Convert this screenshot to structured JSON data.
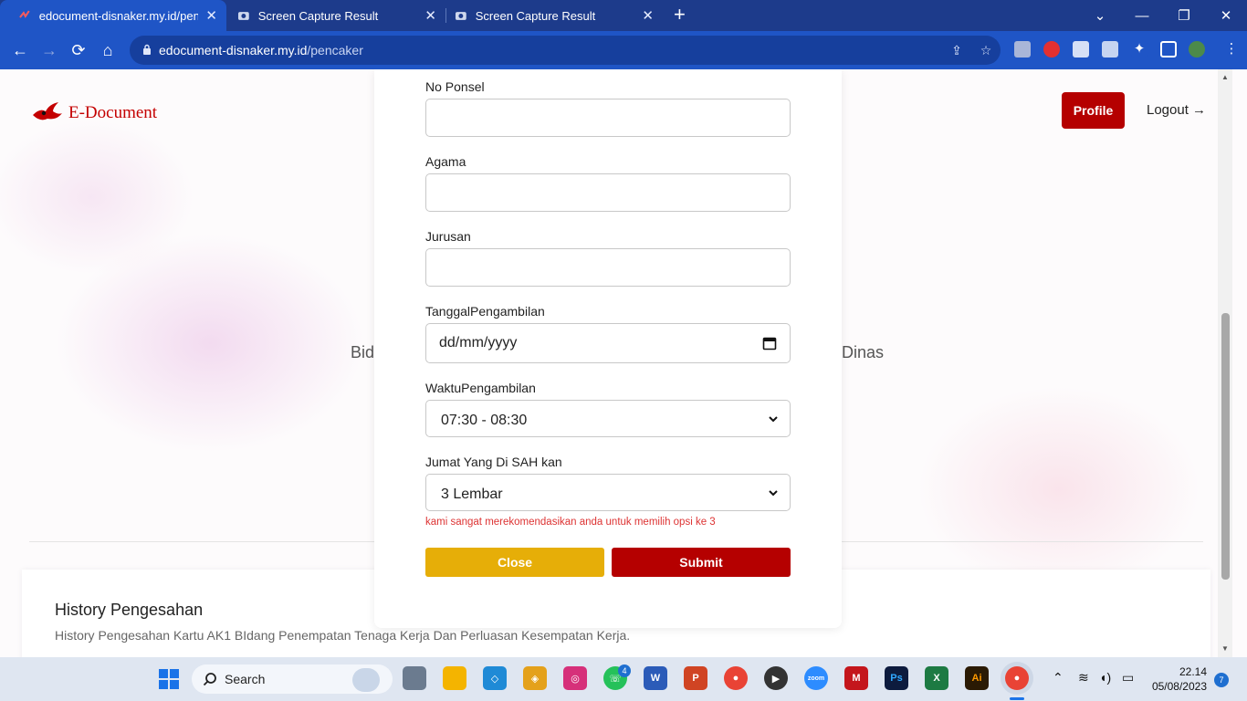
{
  "browser": {
    "tabs": [
      {
        "title": "edocument-disnaker.my.id/pencaker",
        "active": true
      },
      {
        "title": "Screen Capture Result",
        "active": false
      },
      {
        "title": "Screen Capture Result",
        "active": false
      }
    ],
    "url_domain": "edocument-disnaker.my.id",
    "url_path": "/pencaker"
  },
  "header": {
    "logo_text": "E-Document",
    "profile_label": "Profile",
    "logout_label": "Logout →"
  },
  "background": {
    "left_fragment": "Bid",
    "right_fragment": "Dinas"
  },
  "form": {
    "phone_label": "No Ponsel",
    "phone_value": "",
    "religion_label": "Agama",
    "religion_value": "",
    "major_label": "Jurusan",
    "major_value": "",
    "date_label": "TanggalPengambilan",
    "date_placeholder": "dd/mm/yyyy",
    "time_label": "WaktuPengambilan",
    "time_value": "07:30 - 08:30",
    "count_label": "Jumat Yang Di SAH kan",
    "count_value": "3 Lembar",
    "hint": "kami sangat merekomendasikan anda untuk memilih opsi ke 3",
    "close_label": "Close",
    "submit_label": "Submit"
  },
  "history": {
    "title": "History Pengesahan",
    "description": "History Pengesahan Kartu AK1 BIdang Penempatan Tenaga Kerja Dan Perluasan Kesempatan Kerja."
  },
  "taskbar": {
    "search_label": "Search",
    "whatsapp_badge": "4",
    "time": "22.14",
    "date": "05/08/2023",
    "notification_count": "7"
  },
  "colors": {
    "tabbar": "#1d3b8b",
    "toolbar": "#1f55c6",
    "brand_red": "#b50000",
    "close_yellow": "#e6ae08",
    "hint_red": "#dd3333"
  }
}
